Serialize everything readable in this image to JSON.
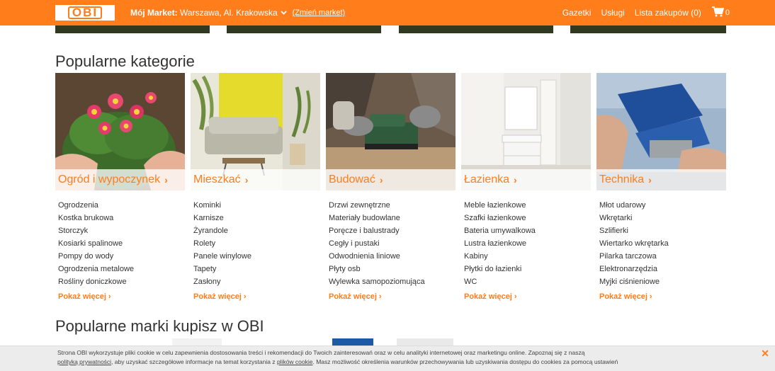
{
  "header": {
    "logo_text": "OBI",
    "market_label": "Mój Market:",
    "market_value": "Warszawa, Al. Krakowska",
    "change_market": "(Zmień market)",
    "links": [
      "Gazetki",
      "Usługi",
      "Lista zakupów (0)"
    ],
    "cart_count": "0"
  },
  "popular_categories": {
    "title": "Popularne kategorie",
    "categories": [
      {
        "name": "Ogród i wypoczynek",
        "items": [
          "Ogrodzenia",
          "Kostka brukowa",
          "Storczyk",
          "Kosiarki spalinowe",
          "Pompy do wody",
          "Ogrodzenia metalowe",
          "Rośliny doniczkowe"
        ],
        "more": "Pokaż więcej"
      },
      {
        "name": "Mieszkać",
        "items": [
          "Kominki",
          "Karnisze",
          "Żyrandole",
          "Rolety",
          "Panele winylowe",
          "Tapety",
          "Zasłony"
        ],
        "more": "Pokaż więcej"
      },
      {
        "name": "Budować",
        "items": [
          "Drzwi zewnętrzne",
          "Materiały budowlane",
          "Poręcze i balustrady",
          "Cegły i pustaki",
          "Odwodnienia liniowe",
          "Płyty osb",
          "Wylewka samopoziomująca"
        ],
        "more": "Pokaż więcej"
      },
      {
        "name": "Łazienka",
        "items": [
          "Meble łazienkowe",
          "Szafki łazienkowe",
          "Bateria umywalkowa",
          "Lustra łazienkowe",
          "Kabiny",
          "Płytki do łazienki",
          "WC"
        ],
        "more": "Pokaż więcej"
      },
      {
        "name": "Technika",
        "items": [
          "Młot udarowy",
          "Wkrętarki",
          "Szlifierki",
          "Wiertarko wkrętarka",
          "Pilarka tarczowa",
          "Elektronarzędzia",
          "Myjki ciśnieniowe"
        ],
        "more": "Pokaż więcej"
      }
    ]
  },
  "popular_brands": {
    "title": "Popularne marki kupisz w OBI"
  },
  "cookie": {
    "text_1": "Strona OBI wykorzystuje pliki cookie w celu zapewnienia dostosowania treści i rekomendacji do Twoich zainteresowań oraz w celu analityki internetowej oraz marketingu online. Zapoznaj się z naszą",
    "privacy_link": "polityką prywatności",
    "text_2": ", aby uzyskać szczegółowe informacje na temat korzystania z",
    "cookie_link": "plików cookie",
    "text_3": ". Masz możliwość określenia warunków przechowywania lub uzyskiwania dostępu do cookies za pomocą ustawień",
    "close_symbol": "✕"
  },
  "colors": {
    "brand_orange": "#ff7d1a"
  }
}
